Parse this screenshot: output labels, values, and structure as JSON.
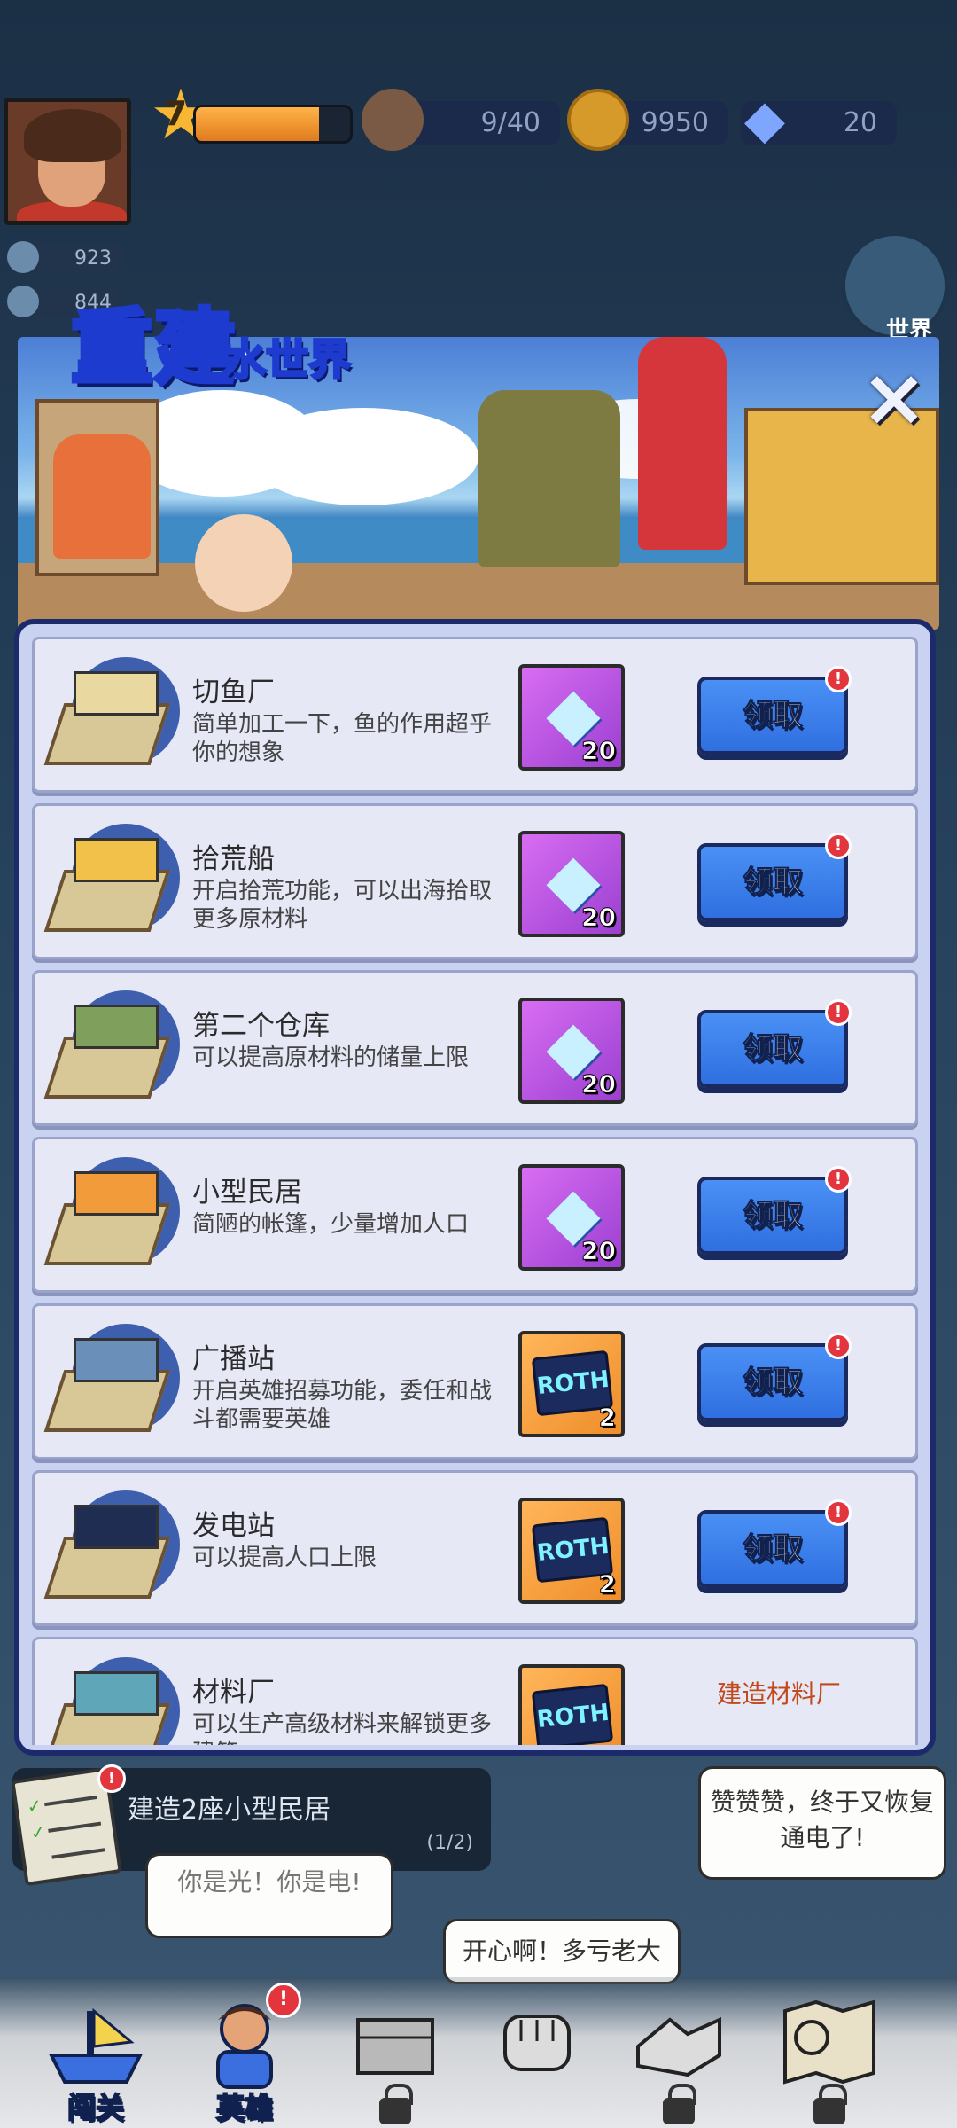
{
  "hud": {
    "level": "7",
    "xp_fraction": 0.8,
    "population": "9/40",
    "coins": "9950",
    "gems": "20",
    "side_stats": [
      "923",
      "844"
    ],
    "world_label": "世界"
  },
  "modal": {
    "title_main": "重建",
    "title_sub": "水世界",
    "close_icon": "×",
    "items": [
      {
        "title": "切鱼厂",
        "desc": "简单加工一下，鱼的作用超乎你的想象",
        "reward_type": "gem",
        "reward_qty": "20",
        "action": "领取",
        "alert": "!"
      },
      {
        "title": "拾荒船",
        "desc": "开启拾荒功能，可以出海拾取更多原材料",
        "reward_type": "gem",
        "reward_qty": "20",
        "action": "领取",
        "alert": "!"
      },
      {
        "title": "第二个仓库",
        "desc": "可以提高原材料的储量上限",
        "reward_type": "gem",
        "reward_qty": "20",
        "action": "领取",
        "alert": "!"
      },
      {
        "title": "小型民居",
        "desc": "简陋的帐篷，少量增加人口",
        "reward_type": "gem",
        "reward_qty": "20",
        "action": "领取",
        "alert": "!"
      },
      {
        "title": "广播站",
        "desc": "开启英雄招募功能，委任和战斗都需要英雄",
        "reward_type": "card",
        "reward_qty": "2",
        "action": "领取",
        "alert": "!"
      },
      {
        "title": "发电站",
        "desc": "可以提高人口上限",
        "reward_type": "card",
        "reward_qty": "2",
        "action": "领取",
        "alert": "!"
      },
      {
        "title": "材料厂",
        "desc": "可以生产高级材料来解锁更多建筑",
        "reward_type": "card",
        "reward_qty": "",
        "action": "建造材料厂",
        "alert": ""
      }
    ],
    "card_label": "ROTH"
  },
  "quest": {
    "title": "建造2座小型民居",
    "progress": "(1/2)",
    "badge": "!"
  },
  "bubbles": {
    "b1": "赞赞赞，终于又恢复通电了!",
    "b2": "开心啊！多亏老大",
    "b3": "你是光！你是电!"
  },
  "nav": {
    "items": [
      "闯关",
      "英雄",
      "",
      "",
      "",
      ""
    ],
    "alert": "!"
  },
  "colors": {
    "accent_blue": "#2f6fe0",
    "panel_border": "#1c2a6b",
    "alert_red": "#e3353d"
  }
}
